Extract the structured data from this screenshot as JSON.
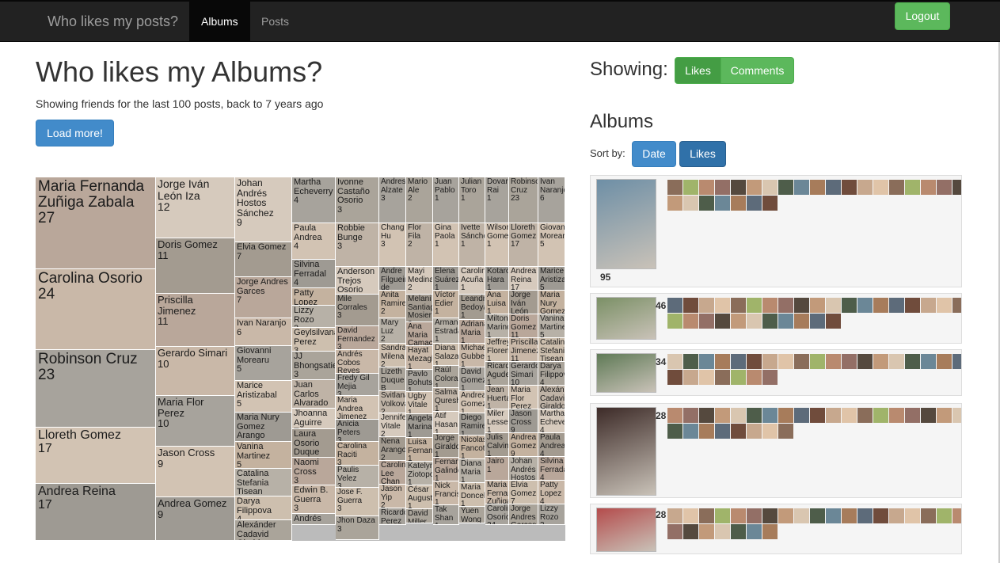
{
  "navbar": {
    "brand": "Who likes my posts?",
    "tabs": [
      {
        "label": "Albums",
        "active": true
      },
      {
        "label": "Posts",
        "active": false
      }
    ],
    "logout_label": "Logout"
  },
  "main": {
    "title": "Who likes my Albums?",
    "subtitle": "Showing friends for the last 100 posts, back to 7 years ago",
    "load_more_label": "Load more!"
  },
  "treemap_people": [
    {
      "name": "Maria Fernanda Zuñiga Zabala",
      "count": "27"
    },
    {
      "name": "Carolina Osorio",
      "count": "24"
    },
    {
      "name": "Robinson Cruz",
      "count": "23"
    },
    {
      "name": "Lloreth Gomez",
      "count": "17"
    },
    {
      "name": "Andrea Reina",
      "count": "17"
    },
    {
      "name": "Jorge Iván León Iza",
      "count": "12"
    },
    {
      "name": "Doris Gomez",
      "count": "11"
    },
    {
      "name": "Priscilla Jimenez",
      "count": "11"
    },
    {
      "name": "Gerardo Simari",
      "count": "10"
    },
    {
      "name": "Maria Flor Perez",
      "count": "10"
    },
    {
      "name": "Jason Cross",
      "count": "9"
    },
    {
      "name": "Andrea Gomez",
      "count": "9"
    },
    {
      "name": "Johan Andrés Hostos Sánchez",
      "count": "9"
    },
    {
      "name": "Elvia Gomez",
      "count": "7"
    },
    {
      "name": "Jorge Andres Garces",
      "count": "7"
    },
    {
      "name": "Ivan Naranjo",
      "count": "6"
    },
    {
      "name": "Giovanni Morearu",
      "count": "5"
    },
    {
      "name": "Marice Aristizabal",
      "count": "5"
    },
    {
      "name": "Maria Nury Gomez Arango",
      "count": "5"
    },
    {
      "name": "Vanina Martinez",
      "count": "5"
    },
    {
      "name": "Catalina Stefania Tisean",
      "count": "4"
    },
    {
      "name": "Darya Filippova",
      "count": "4"
    },
    {
      "name": "Alexánder Cadavid Giraldo",
      "count": "4"
    },
    {
      "name": "Martha Echeverry",
      "count": "4"
    },
    {
      "name": "Paula Andrea",
      "count": "4"
    },
    {
      "name": "Silvina Ferradal",
      "count": "4"
    },
    {
      "name": "Patty Lopez",
      "count": "4"
    },
    {
      "name": "Lizzy Rozo",
      "count": "3"
    },
    {
      "name": "Geylsilvana Perez",
      "count": "3"
    },
    {
      "name": "JJ Bhongsatiern",
      "count": "3"
    },
    {
      "name": "Juan Carlos Alvarado",
      "count": "3"
    },
    {
      "name": "Jhoanna Aguirre Toro",
      "count": "3"
    },
    {
      "name": "Laura Osorio Duque",
      "count": "3"
    },
    {
      "name": "Naomi Cross",
      "count": "3"
    },
    {
      "name": "Edwin B. Guerra",
      "count": "3"
    },
    {
      "name": "Andrés Toro",
      "count": "3"
    },
    {
      "name": "Ivonne Castaño Osorio",
      "count": "3"
    },
    {
      "name": "Robbie Bunge",
      "count": "3"
    },
    {
      "name": "Anderson Trejos Osorio",
      "count": "3"
    },
    {
      "name": "Mile Corrales",
      "count": "3"
    },
    {
      "name": "David Fernandez",
      "count": "3"
    },
    {
      "name": "Andrés Cobos Reyes",
      "count": "3"
    },
    {
      "name": "Fredy Gil Mejia",
      "count": "3"
    },
    {
      "name": "Maria Andrea Jimenez",
      "count": "3"
    },
    {
      "name": "Anicia Peters",
      "count": "3"
    },
    {
      "name": "Carolina Raciti",
      "count": "3"
    },
    {
      "name": "Paulis Velez",
      "count": "3"
    },
    {
      "name": "Jose F. Guerra",
      "count": "3"
    },
    {
      "name": "Jhon Daza",
      "count": "3"
    },
    {
      "name": "Andres Alzate",
      "count": "3"
    },
    {
      "name": "Chang Hu",
      "count": "3"
    },
    {
      "name": "Andre Filgueiras de",
      "count": "3"
    },
    {
      "name": "Anita Ramirez",
      "count": "2"
    },
    {
      "name": "Mary Luz",
      "count": "2"
    },
    {
      "name": "Sandra Milena",
      "count": "2"
    },
    {
      "name": "Lizeth Duque B",
      "count": "2"
    },
    {
      "name": "Svitlana Volkova",
      "count": "2"
    },
    {
      "name": "Jennifer Vitale",
      "count": "2"
    },
    {
      "name": "Nena Arango",
      "count": "2"
    },
    {
      "name": "Carolina Lee Chan",
      "count": "2"
    },
    {
      "name": "Jason Yip",
      "count": "2"
    },
    {
      "name": "Ricardo Perez R",
      "count": "2"
    },
    {
      "name": "Mario Ale",
      "count": "2"
    },
    {
      "name": "Flor Fila",
      "count": "2"
    },
    {
      "name": "Mayi Medina",
      "count": "2"
    },
    {
      "name": "Melani Santiago Mosier",
      "count": "2"
    },
    {
      "name": "Ana Maria Camacho Castro",
      "count": "2"
    },
    {
      "name": "Hayat Mezagh",
      "count": "1"
    },
    {
      "name": "Pavlo Bohuts",
      "count": "1"
    },
    {
      "name": "Ugby Vitale",
      "count": "1"
    },
    {
      "name": "Angela Marina",
      "count": "1"
    },
    {
      "name": "Luisa Fernanda",
      "count": "1"
    },
    {
      "name": "Katelyn Ziotopoulos",
      "count": "1"
    },
    {
      "name": "César Augusto",
      "count": "1"
    },
    {
      "name": "David Miller",
      "count": "1"
    },
    {
      "name": "Juan Pablo",
      "count": "1"
    },
    {
      "name": "Gina Paola",
      "count": "1"
    },
    {
      "name": "Elena Suárez",
      "count": "1"
    },
    {
      "name": "Víctor Edier",
      "count": "1"
    },
    {
      "name": "Armando Estrada",
      "count": "1"
    },
    {
      "name": "Diana Salazar",
      "count": "1"
    },
    {
      "name": "Raúl Colorado",
      "count": "1"
    },
    {
      "name": "Salma Qureshi",
      "count": "1"
    },
    {
      "name": "Atif Hasan",
      "count": "1"
    },
    {
      "name": "Jorge Giraldo",
      "count": "1"
    },
    {
      "name": "Fernando Galindo",
      "count": "1"
    },
    {
      "name": "Nick Francis",
      "count": "1"
    },
    {
      "name": "Tak Shan",
      "count": "1"
    },
    {
      "name": "Julian Toro",
      "count": "1"
    },
    {
      "name": "Ivette Sánchez",
      "count": "1"
    },
    {
      "name": "Carolina Acuña",
      "count": "1"
    },
    {
      "name": "Leandro Bedoya",
      "count": "1"
    },
    {
      "name": "Adriana Maria",
      "count": "1"
    },
    {
      "name": "Michael Gubbels",
      "count": "1"
    },
    {
      "name": "David Gomez",
      "count": "1"
    },
    {
      "name": "Andrea Gomez",
      "count": "1"
    },
    {
      "name": "Diego Ramirez",
      "count": "1"
    },
    {
      "name": "Nicolas Fancotti",
      "count": "1"
    },
    {
      "name": "Diana Maria",
      "count": "1"
    },
    {
      "name": "Maria Doncel",
      "count": "1"
    },
    {
      "name": "Yuen Wong",
      "count": "1"
    },
    {
      "name": "Dovar Rai",
      "count": "1"
    },
    {
      "name": "Wilson Gomez",
      "count": "1"
    },
    {
      "name": "Kotaro Hara",
      "count": "1"
    },
    {
      "name": "Ana Luisa",
      "count": "1"
    },
    {
      "name": "Milton Marino",
      "count": "1"
    },
    {
      "name": "Jeffrey Florence",
      "count": "1"
    },
    {
      "name": "Ricardo Agudelo",
      "count": "1"
    },
    {
      "name": "Jean Huertas",
      "count": "1"
    },
    {
      "name": "Miler Lesser",
      "count": "1"
    },
    {
      "name": "Julis Calvin",
      "count": "1"
    },
    {
      "name": "Jairo",
      "count": "1"
    }
  ],
  "right": {
    "showing_label": "Showing:",
    "toggle_likes": "Likes",
    "toggle_comments": "Comments",
    "albums_title": "Albums",
    "sort_by_label": "Sort by:",
    "sort_date": "Date",
    "sort_likes": "Likes"
  },
  "albums": [
    {
      "likes": "95",
      "avatars": 26
    },
    {
      "likes": "46",
      "avatars": 30
    },
    {
      "likes": "34",
      "avatars": 26
    },
    {
      "likes": "28",
      "avatars": 27
    },
    {
      "likes": "28",
      "avatars": 26
    }
  ],
  "colors": {
    "navbar": "#222222",
    "success": "#5cb85c",
    "primary": "#428bca",
    "primary_active": "#3071a9",
    "album_bg": "#f5f5f5"
  }
}
